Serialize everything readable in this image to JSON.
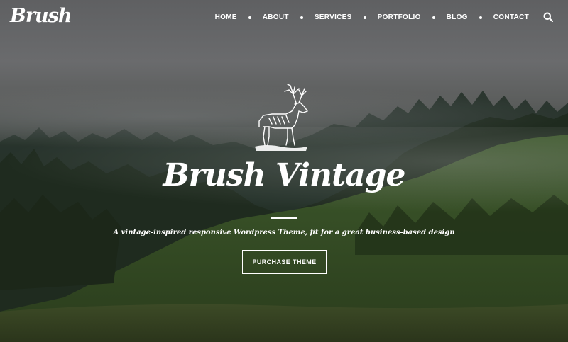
{
  "header": {
    "logo_text": "Brush",
    "nav": [
      {
        "label": "HOME"
      },
      {
        "label": "ABOUT"
      },
      {
        "label": "SERVICES"
      },
      {
        "label": "PORTFOLIO"
      },
      {
        "label": "BLOG"
      },
      {
        "label": "CONTACT"
      }
    ],
    "search_icon": "search-icon"
  },
  "hero": {
    "emblem_icon": "elk-icon",
    "title": "Brush Vintage",
    "tagline": "A vintage-inspired responsive Wordpress Theme, fit for a great business-based design",
    "cta_label": "PURCHASE THEME"
  },
  "colors": {
    "text": "#ffffff",
    "sky": "#646567",
    "forest": "#24331f"
  }
}
